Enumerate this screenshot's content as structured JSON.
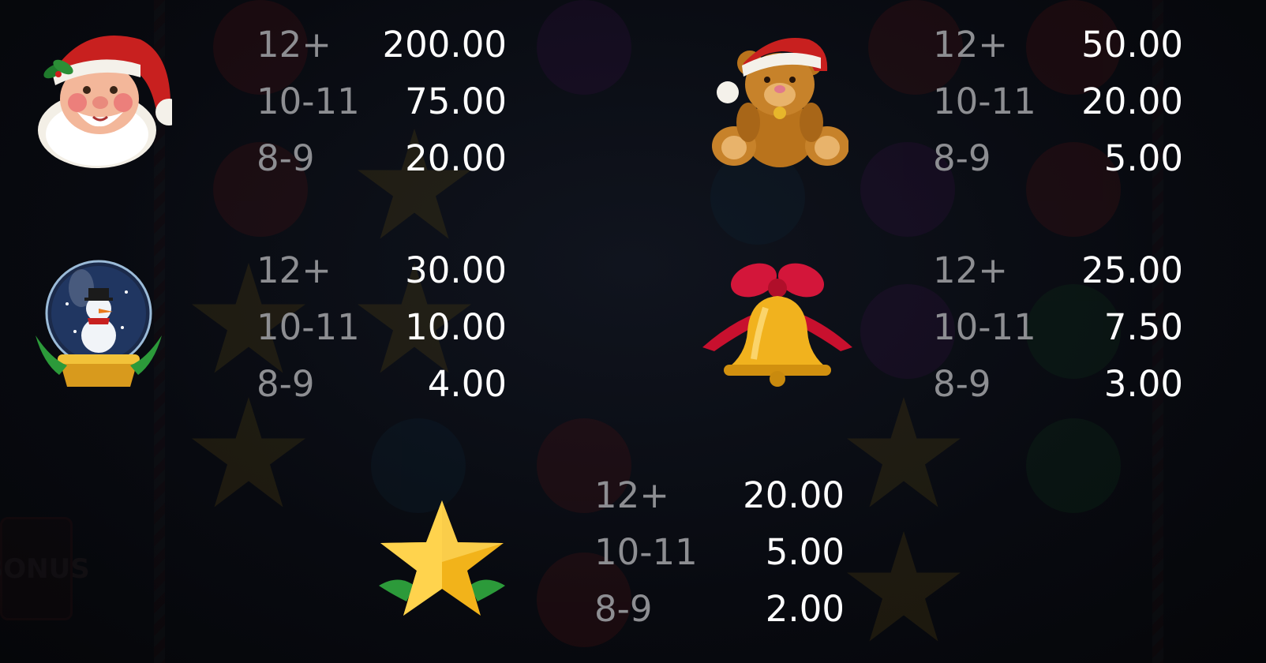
{
  "background": {
    "bonus_label": "BONUS"
  },
  "paytable": [
    {
      "symbol_icon": "santa-icon",
      "rows": [
        {
          "count": "12+",
          "payout": "200.00"
        },
        {
          "count": "10-11",
          "payout": "75.00"
        },
        {
          "count": "8-9",
          "payout": "20.00"
        }
      ]
    },
    {
      "symbol_icon": "teddy-bear-icon",
      "rows": [
        {
          "count": "12+",
          "payout": "50.00"
        },
        {
          "count": "10-11",
          "payout": "20.00"
        },
        {
          "count": "8-9",
          "payout": "5.00"
        }
      ]
    },
    {
      "symbol_icon": "snow-globe-icon",
      "rows": [
        {
          "count": "12+",
          "payout": "30.00"
        },
        {
          "count": "10-11",
          "payout": "10.00"
        },
        {
          "count": "8-9",
          "payout": "4.00"
        }
      ]
    },
    {
      "symbol_icon": "bell-icon",
      "rows": [
        {
          "count": "12+",
          "payout": "25.00"
        },
        {
          "count": "10-11",
          "payout": "7.50"
        },
        {
          "count": "8-9",
          "payout": "3.00"
        }
      ]
    },
    {
      "symbol_icon": "star-icon",
      "rows": [
        {
          "count": "12+",
          "payout": "20.00"
        },
        {
          "count": "10-11",
          "payout": "5.00"
        },
        {
          "count": "8-9",
          "payout": "2.00"
        }
      ]
    }
  ],
  "colors": {
    "count_text": "#8d8e92",
    "payout_text": "#ffffff",
    "background": "#07090e"
  }
}
